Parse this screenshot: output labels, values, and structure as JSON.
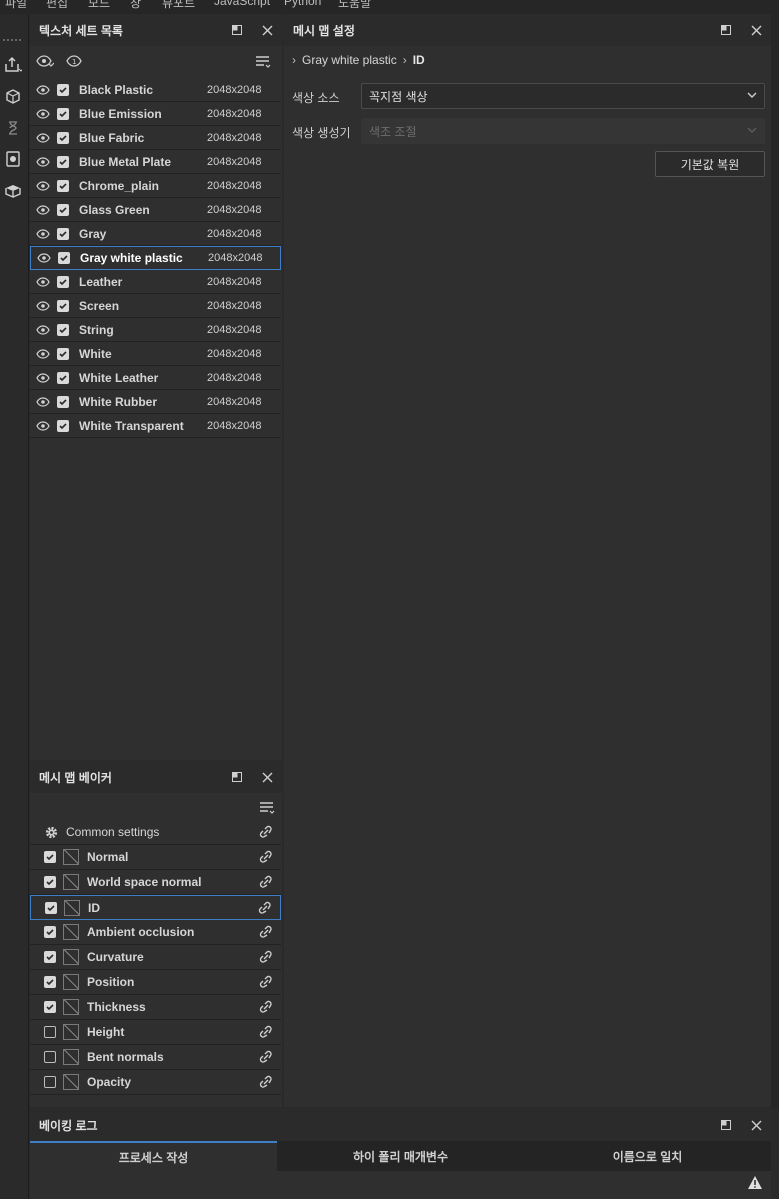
{
  "menubar": [
    "파일",
    "편집",
    "모드",
    "창",
    "뷰포트",
    "JavaScript",
    "Python",
    "도움말"
  ],
  "texture_set_list": {
    "title": "텍스처 세트 목록",
    "items": [
      {
        "name": "Black Plastic",
        "size": "2048x2048"
      },
      {
        "name": "Blue Emission",
        "size": "2048x2048"
      },
      {
        "name": "Blue Fabric",
        "size": "2048x2048"
      },
      {
        "name": "Blue Metal Plate",
        "size": "2048x2048"
      },
      {
        "name": "Chrome_plain",
        "size": "2048x2048"
      },
      {
        "name": "Glass Green",
        "size": "2048x2048"
      },
      {
        "name": "Gray",
        "size": "2048x2048"
      },
      {
        "name": "Gray white plastic",
        "size": "2048x2048"
      },
      {
        "name": "Leather",
        "size": "2048x2048"
      },
      {
        "name": "Screen",
        "size": "2048x2048"
      },
      {
        "name": "String",
        "size": "2048x2048"
      },
      {
        "name": "White",
        "size": "2048x2048"
      },
      {
        "name": "White Leather",
        "size": "2048x2048"
      },
      {
        "name": "White Rubber",
        "size": "2048x2048"
      },
      {
        "name": "White Transparent",
        "size": "2048x2048"
      }
    ],
    "selected": "Gray white plastic"
  },
  "mesh_map_settings": {
    "title": "메시 맵 설정",
    "breadcrumb": [
      "Gray white plastic",
      "ID"
    ],
    "color_source_label": "색상 소스",
    "color_source_value": "꼭지점 색상",
    "color_generator_label": "색상 생성기",
    "color_generator_value": "색조 조절",
    "reset_button": "기본값 복원"
  },
  "mesh_map_baker": {
    "title": "메시 맵 베이커",
    "common_settings": "Common settings",
    "maps": [
      {
        "name": "Normal",
        "checked": true
      },
      {
        "name": "World space normal",
        "checked": true
      },
      {
        "name": "ID",
        "checked": true
      },
      {
        "name": "Ambient occlusion",
        "checked": true
      },
      {
        "name": "Curvature",
        "checked": true
      },
      {
        "name": "Position",
        "checked": true
      },
      {
        "name": "Thickness",
        "checked": true
      },
      {
        "name": "Height",
        "checked": false
      },
      {
        "name": "Bent normals",
        "checked": false
      },
      {
        "name": "Opacity",
        "checked": false
      }
    ],
    "selected": "ID"
  },
  "baking_log": {
    "title": "베이킹 로그",
    "tabs": [
      "프로세스 작성",
      "하이 폴리 매개변수",
      "이름으로 일치"
    ]
  },
  "colors": {
    "accent": "#3d7ec6",
    "panel_bg": "#2f2f2f",
    "header_bg": "#2b2b2b"
  }
}
